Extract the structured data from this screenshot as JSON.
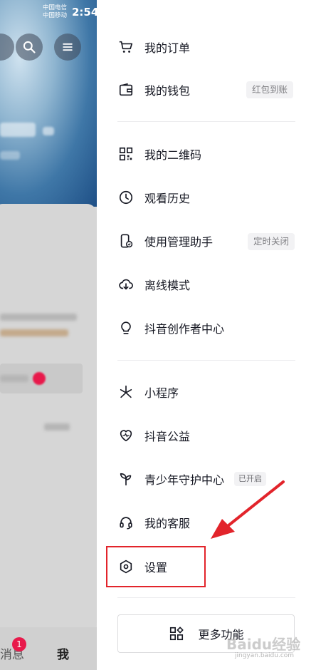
{
  "status_bar": {
    "carrier1": "中国电信",
    "carrier2": "中国移动",
    "time": "2:54"
  },
  "left_panel": {
    "badge_count": "1",
    "bottom_nav": {
      "messages": "消息",
      "me": "我"
    }
  },
  "menu": {
    "items": [
      {
        "label": "我的订单",
        "icon": "cart-icon"
      },
      {
        "label": "我的钱包",
        "icon": "wallet-icon",
        "tag": "红包到账"
      },
      {
        "label": "我的二维码",
        "icon": "qrcode-icon"
      },
      {
        "label": "观看历史",
        "icon": "clock-icon"
      },
      {
        "label": "使用管理助手",
        "icon": "phone-manage-icon",
        "tag": "定时关闭"
      },
      {
        "label": "离线模式",
        "icon": "cloud-download-icon"
      },
      {
        "label": "抖音创作者中心",
        "icon": "bulb-icon"
      },
      {
        "label": "小程序",
        "icon": "miniprogram-icon"
      },
      {
        "label": "抖音公益",
        "icon": "heart-icon"
      },
      {
        "label": "青少年守护中心",
        "icon": "sprout-icon",
        "tag": "已开启"
      },
      {
        "label": "我的客服",
        "icon": "headset-icon"
      },
      {
        "label": "设置",
        "icon": "settings-icon"
      }
    ],
    "more_button": "更多功能"
  },
  "watermark": {
    "text": "Baidu经验",
    "sub": "jingyan.baidu.com"
  },
  "colors": {
    "highlight": "#e2242b",
    "badge": "#e8194b"
  }
}
